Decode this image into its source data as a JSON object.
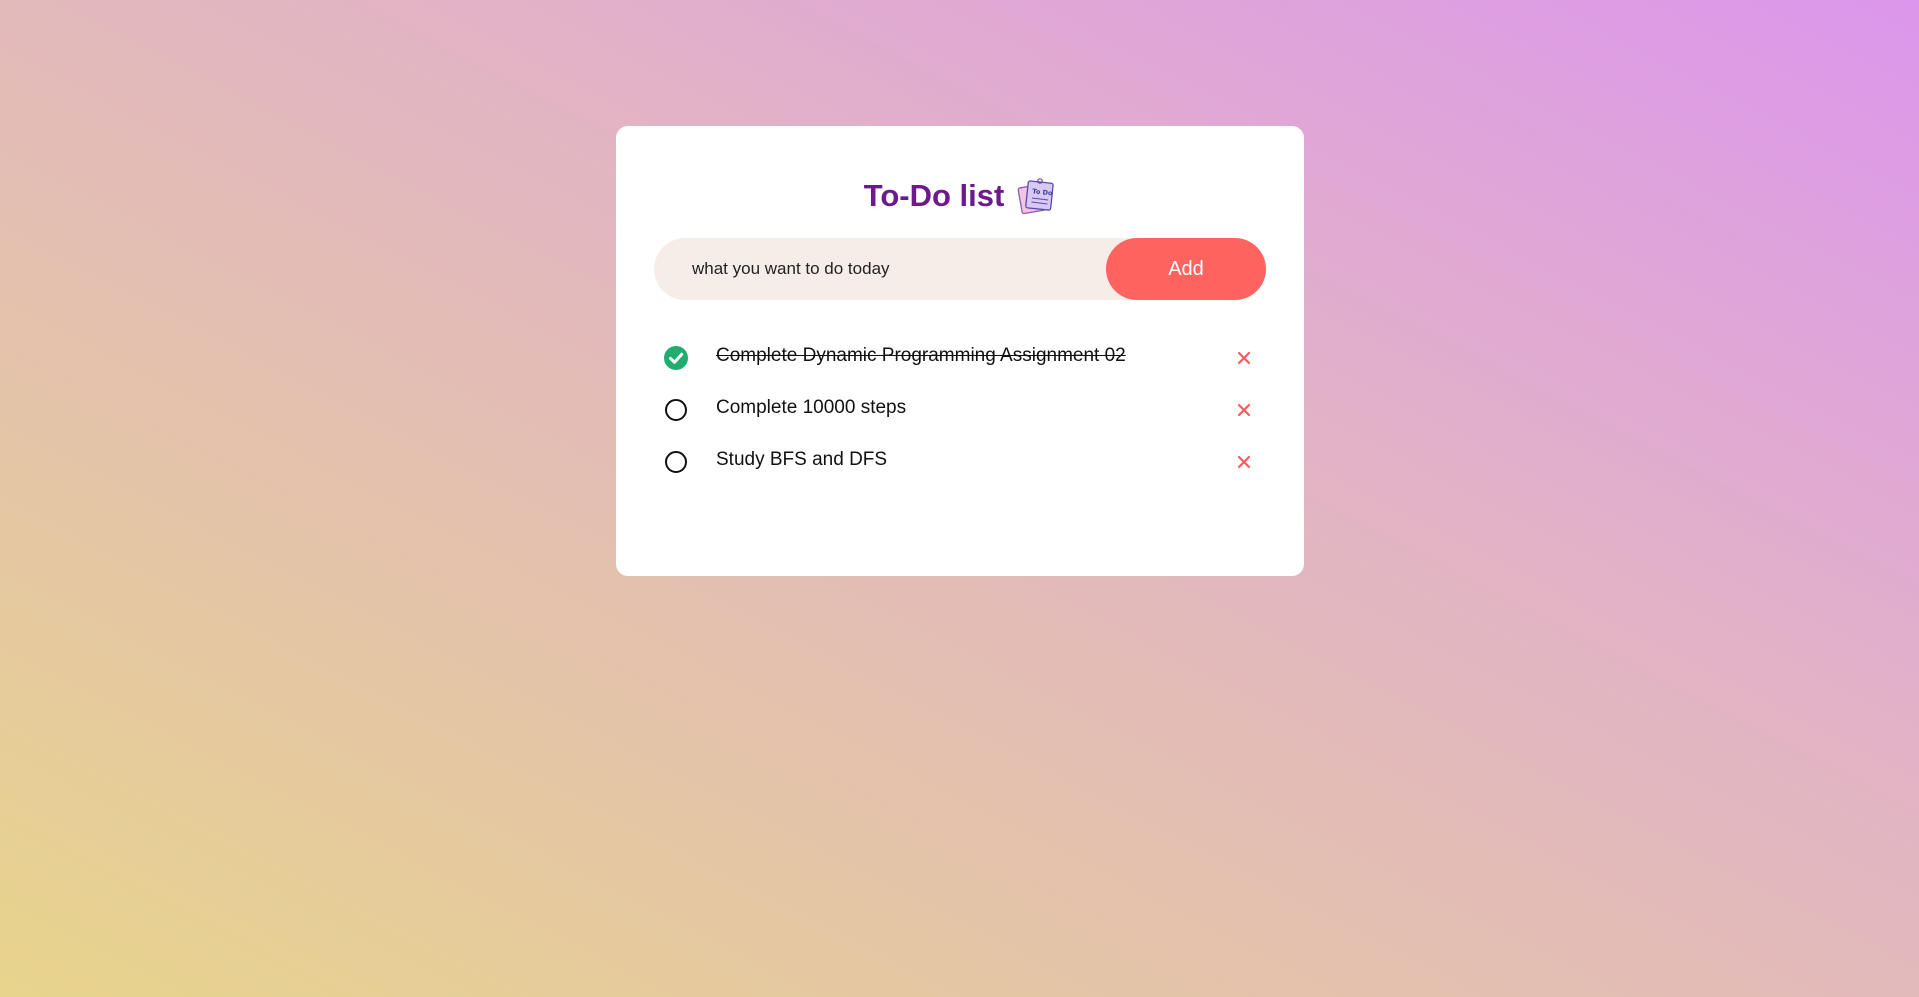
{
  "app": {
    "title": "To-Do list",
    "title_icon": "todo-notepad-icon"
  },
  "input": {
    "placeholder": "what you want to do today",
    "value": ""
  },
  "add_button": {
    "label": "Add"
  },
  "tasks": [
    {
      "text": "Complete Dynamic Programming Assignment 02",
      "done": true
    },
    {
      "text": "Complete 10000 steps",
      "done": false
    },
    {
      "text": "Study BFS and DFS",
      "done": false
    }
  ],
  "colors": {
    "title": "#6c1a8e",
    "add_button": "#ff6360",
    "input_bg": "#f7ede8",
    "checked": "#1fae6f",
    "delete": "#ff5a5a"
  },
  "icons": {
    "checked": "check-circle-icon",
    "unchecked": "empty-circle-icon",
    "delete": "close-icon"
  }
}
